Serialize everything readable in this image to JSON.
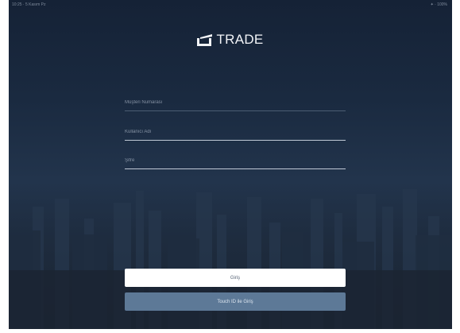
{
  "status_bar": {
    "left_text": "10:25 · 5 Kasım Pz",
    "right_text": "✦ · 100%"
  },
  "logo": {
    "text": "TRADE"
  },
  "form": {
    "customer_number_placeholder": "Müşteri Numarası",
    "username_placeholder": "Kullanıcı Adı",
    "password_placeholder": "Şifre"
  },
  "buttons": {
    "login_label": "Giriş",
    "touch_id_label": "Touch ID ile Giriş"
  },
  "colors": {
    "background": "#1a2a40",
    "touch_button": "#5d7997",
    "login_button": "#ffffff"
  }
}
